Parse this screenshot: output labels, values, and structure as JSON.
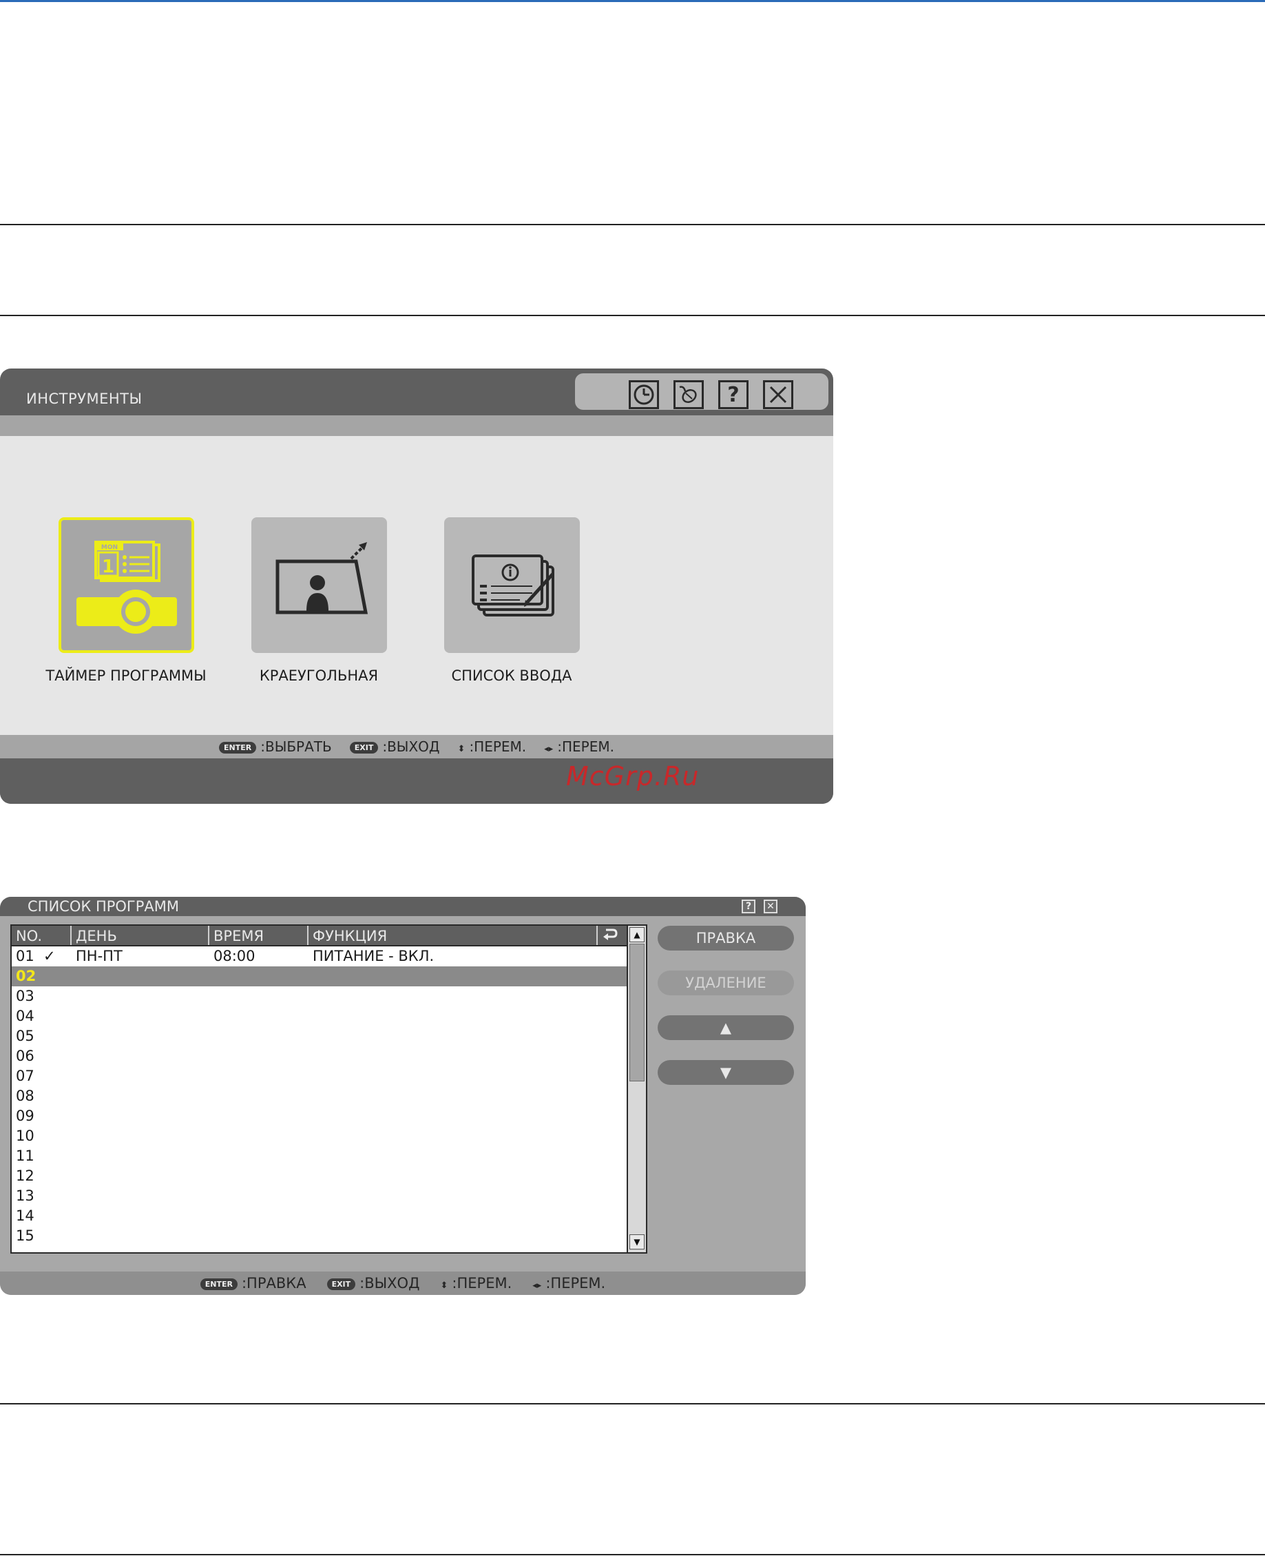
{
  "tools_window": {
    "title": "ИНСТРУМЕНТЫ",
    "toolbar_icons": [
      "clock-icon",
      "mouse-icon",
      "help-icon",
      "close-icon"
    ],
    "help_glyph": "?",
    "tiles": [
      {
        "label": "ТАЙМЕР ПРОГРАММЫ",
        "icon": "program-timer-icon",
        "selected": true,
        "calendar_day": "MON",
        "calendar_date": "1"
      },
      {
        "label": "КРАЕУГОЛЬНАЯ",
        "icon": "cornerstone-icon",
        "selected": false
      },
      {
        "label": "СПИСОК ВВОДА",
        "icon": "input-list-icon",
        "selected": false
      }
    ],
    "footer": {
      "enter_key": "ENTER",
      "enter_action": ":ВЫБРАТЬ",
      "exit_key": "EXIT",
      "exit_action": ":ВЫХОД",
      "updown_action": ":ПЕРЕМ.",
      "leftright_action": ":ПЕРЕМ."
    },
    "watermark": "McGrp.Ru"
  },
  "program_window": {
    "title": "СПИСОК ПРОГРАММ",
    "help_glyph": "?",
    "close_glyph": "✕",
    "columns": [
      "NO.",
      "ДЕНЬ",
      "ВРЕМЯ",
      "ФУНКЦИЯ"
    ],
    "repeat_icon": "repeat-icon",
    "rows": [
      {
        "no": "01",
        "check": "✓",
        "day": "ПН-ПТ",
        "time": "08:00",
        "function": "ПИТАНИЕ - ВКЛ."
      },
      {
        "no": "02",
        "check": "",
        "day": "",
        "time": "",
        "function": ""
      },
      {
        "no": "03",
        "check": "",
        "day": "",
        "time": "",
        "function": ""
      },
      {
        "no": "04",
        "check": "",
        "day": "",
        "time": "",
        "function": ""
      },
      {
        "no": "05",
        "check": "",
        "day": "",
        "time": "",
        "function": ""
      },
      {
        "no": "06",
        "check": "",
        "day": "",
        "time": "",
        "function": ""
      },
      {
        "no": "07",
        "check": "",
        "day": "",
        "time": "",
        "function": ""
      },
      {
        "no": "08",
        "check": "",
        "day": "",
        "time": "",
        "function": ""
      },
      {
        "no": "09",
        "check": "",
        "day": "",
        "time": "",
        "function": ""
      },
      {
        "no": "10",
        "check": "",
        "day": "",
        "time": "",
        "function": ""
      },
      {
        "no": "11",
        "check": "",
        "day": "",
        "time": "",
        "function": ""
      },
      {
        "no": "12",
        "check": "",
        "day": "",
        "time": "",
        "function": ""
      },
      {
        "no": "13",
        "check": "",
        "day": "",
        "time": "",
        "function": ""
      },
      {
        "no": "14",
        "check": "",
        "day": "",
        "time": "",
        "function": ""
      },
      {
        "no": "15",
        "check": "",
        "day": "",
        "time": "",
        "function": ""
      }
    ],
    "selected_row": "02",
    "buttons": {
      "edit": "ПРАВКА",
      "delete": "УДАЛЕНИЕ",
      "up": "▲",
      "down": "▼"
    },
    "scroll_up": "▲",
    "scroll_down": "▼",
    "footer": {
      "enter_key": "ENTER",
      "enter_action": ":ПРАВКА",
      "exit_key": "EXIT",
      "exit_action": ":ВЫХОД",
      "updown_action": ":ПЕРЕМ.",
      "leftright_action": ":ПЕРЕМ."
    }
  },
  "colors": {
    "selection_yellow": "#ecec18",
    "window_dark": "#5f5f5f",
    "window_light": "#e6e6e6",
    "top_rule": "#2b6bb8",
    "watermark": "#c8282a"
  }
}
